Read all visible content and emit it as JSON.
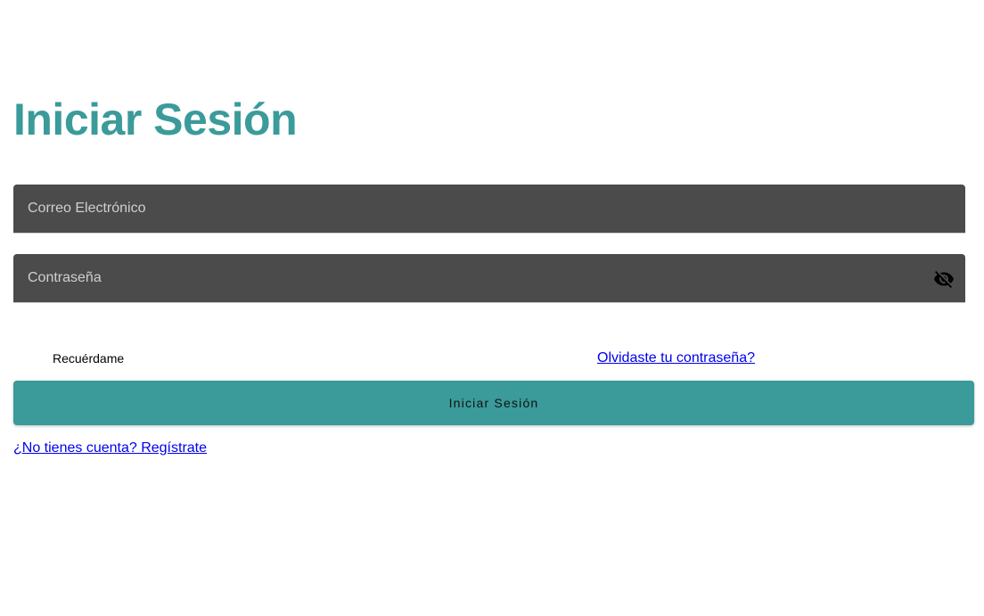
{
  "login": {
    "title": "Iniciar Sesión",
    "email_placeholder": "Correo Electrónico",
    "email_value": "",
    "password_placeholder": "Contraseña",
    "password_value": "",
    "password_toggle_icon": "eye-off-icon",
    "remember_label": "Recuérdame",
    "forgot_link": "Olvidaste tu contraseña?",
    "submit_label": "Iniciar Sesión",
    "register_link": "¿No tienes cuenta? Regístrate"
  },
  "colors": {
    "accent": "#3a9b9a",
    "field_background": "#4b4b4b",
    "link": "#0000ee"
  }
}
